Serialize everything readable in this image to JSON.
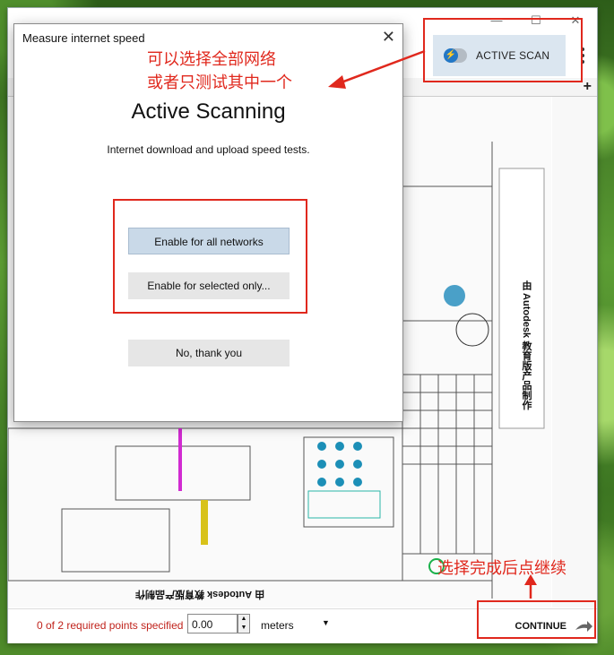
{
  "window": {
    "minimize": "—",
    "maximize": "☐",
    "close": "✕"
  },
  "toolbar": {
    "active_scan_label": "ACTIVE SCAN",
    "toggle_icon": "⚡",
    "add_tab_label": "+"
  },
  "dialog": {
    "title": "Measure internet speed",
    "close_label": "✕",
    "heading": "Active Scanning",
    "subtitle": "Internet download and upload speed tests.",
    "btn_all": "Enable for all networks",
    "btn_selected": "Enable for selected only...",
    "btn_no": "No, thank you"
  },
  "footer": {
    "required_points": "0 of 2 required points specified",
    "distance_value": "0.00",
    "units": "meters",
    "continue_label": "CONTINUE"
  },
  "floor_plan": {
    "watermark_top": "由 Autodesk 教育版产品制作",
    "watermark_bottom": "由 Autodesk 教育版产品制作"
  },
  "annotations": {
    "top_line1": "可以选择全部网络",
    "top_line2": "或者只测试其中一个",
    "bottom": "选择完成后点继续",
    "color": "#e0281d"
  },
  "colors": {
    "accent": "#2277c6",
    "primary_button": "#c9d9e8",
    "warning_text": "#c0231c"
  }
}
